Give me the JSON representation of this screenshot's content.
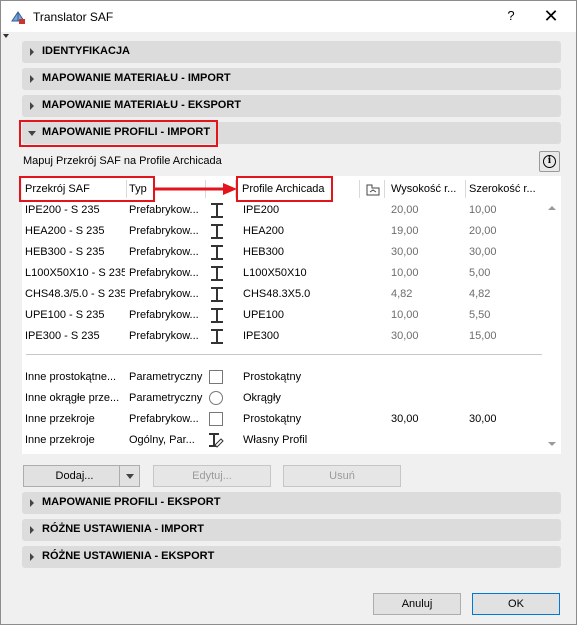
{
  "window": {
    "title": "Translator SAF",
    "help": "?",
    "close": "✕"
  },
  "sections": {
    "identyfikacja": "IDENTYFIKACJA",
    "mat_import": "MAPOWANIE MATERIAŁU - IMPORT",
    "mat_export": "MAPOWANIE MATERIAŁU - EKSPORT",
    "prof_import": "MAPOWANIE PROFILI - IMPORT",
    "prof_export": "MAPOWANIE PROFILI - EKSPORT",
    "misc_import": "RÓŻNE USTAWIENIA - IMPORT",
    "misc_export": "RÓŻNE USTAWIENIA - EKSPORT"
  },
  "panel": {
    "description": "Mapuj Przekrój SAF na Profile Archicada",
    "info_icon": "i"
  },
  "table": {
    "headers": {
      "saf": "Przekrój SAF",
      "type": "Typ",
      "profile": "Profile Archicada",
      "height": "Wysokość r...",
      "width": "Szerokość r..."
    },
    "rows": [
      {
        "saf": "IPE200 - S 235",
        "type": "Prefabrykow...",
        "icon": "ibeam-icon",
        "profile": "IPE200",
        "height": "20,00",
        "width": "10,00"
      },
      {
        "saf": "HEA200 - S 235",
        "type": "Prefabrykow...",
        "icon": "ibeam-icon",
        "profile": "HEA200",
        "height": "19,00",
        "width": "20,00"
      },
      {
        "saf": "HEB300 - S 235",
        "type": "Prefabrykow...",
        "icon": "ibeam-icon",
        "profile": "HEB300",
        "height": "30,00",
        "width": "30,00"
      },
      {
        "saf": "L100X50X10 - S 235",
        "type": "Prefabrykow...",
        "icon": "ibeam-icon",
        "profile": "L100X50X10",
        "height": "10,00",
        "width": "5,00"
      },
      {
        "saf": "CHS48.3/5.0 - S 235",
        "type": "Prefabrykow...",
        "icon": "ibeam-icon",
        "profile": "CHS48.3X5.0",
        "height": "4,82",
        "width": "4,82"
      },
      {
        "saf": "UPE100 - S 235",
        "type": "Prefabrykow...",
        "icon": "ibeam-icon",
        "profile": "UPE100",
        "height": "10,00",
        "width": "5,50"
      },
      {
        "saf": "IPE300 - S 235",
        "type": "Prefabrykow...",
        "icon": "ibeam-icon",
        "profile": "IPE300",
        "height": "30,00",
        "width": "15,00"
      }
    ],
    "other_rows": [
      {
        "saf": "Inne prostokątne...",
        "type": "Parametryczny",
        "icon": "rectangle-icon",
        "profile": "Prostokątny",
        "height": "",
        "width": ""
      },
      {
        "saf": "Inne okrągłe prze...",
        "type": "Parametryczny",
        "icon": "circle-icon",
        "profile": "Okrągły",
        "height": "",
        "width": ""
      },
      {
        "saf": "Inne przekroje",
        "type": "Prefabrykow...",
        "icon": "rectangle-icon",
        "profile": "Prostokątny",
        "height": "30,00",
        "width": "30,00"
      },
      {
        "saf": "Inne przekroje",
        "type": "Ogólny, Par...",
        "icon": "custom-profile-icon",
        "profile": "Własny Profil",
        "height": "",
        "width": ""
      }
    ]
  },
  "buttons": {
    "add": "Dodaj...",
    "edit": "Edytuj...",
    "remove": "Usuń",
    "cancel": "Anuluj",
    "ok": "OK"
  },
  "colors": {
    "highlight": "#e3141b",
    "arrow": "#e3141b"
  }
}
